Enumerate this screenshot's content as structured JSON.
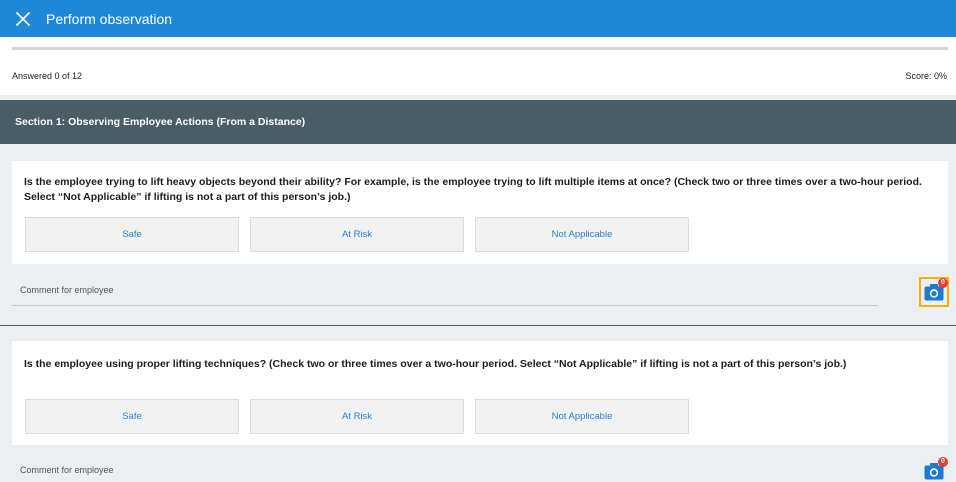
{
  "appbar": {
    "title": "Perform observation",
    "close_icon": "close-icon"
  },
  "progress": {
    "answered": "Answered 0 of 12",
    "score": "Score: 0%",
    "fraction": 0
  },
  "section": {
    "title": "Section 1: Observing Employee Actions (From a Distance)"
  },
  "questions": [
    {
      "text": "Is the employee trying to lift heavy objects beyond their ability? For example, is the employee trying to lift multiple items at once?   (Check two or three times over a two-hour period. Select “Not Applicable” if lifting is not a part of this person’s job.)",
      "options": [
        "Safe",
        "At Risk",
        "Not Applicable"
      ],
      "comment_placeholder": "Comment for employee",
      "photo_count": "0"
    },
    {
      "text": "Is the employee using proper lifting techniques?   (Check two or three times over a two-hour period. Select “Not Applicable” if lifting is not a part of this person’s job.)",
      "options": [
        "Safe",
        "At Risk",
        "Not Applicable"
      ],
      "comment_placeholder": "Comment for employee",
      "photo_count": "0"
    }
  ],
  "colors": {
    "appbar": "#1e88d8",
    "section_header": "#4a5c66",
    "button_text": "#2a7fd0",
    "highlight": "#f0b400",
    "badge": "#e53935"
  }
}
